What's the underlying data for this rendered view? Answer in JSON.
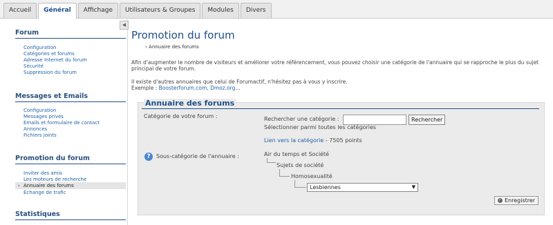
{
  "tabs": [
    "Accueil",
    "Général",
    "Affichage",
    "Utilisateurs & Groupes",
    "Modules",
    "Divers"
  ],
  "sidebar": {
    "collapse_glyph": "◀",
    "sections": [
      {
        "title": "Forum",
        "items": [
          "Configuration",
          "Catégories et forums",
          "Adresse Internet du forum",
          "Sécurité",
          "Suppression du forum"
        ]
      },
      {
        "title": "Messages et Emails",
        "items": [
          "Configuration",
          "Messages privés",
          "Emails et formulaire de contact",
          "Annonces",
          "Fichiers joints"
        ]
      },
      {
        "title": "Promotion du forum",
        "items": [
          "Inviter des amis",
          "Les moteurs de recherche",
          "Annuaire des forums",
          "Échange de trafic"
        ]
      },
      {
        "title": "Statistiques",
        "items": []
      }
    ]
  },
  "main": {
    "title": "Promotion du forum",
    "breadcrumb": "› Annuaire des forums",
    "intro": "Afin d'augmenter le nombre de visiteurs et améliorer votre référencement, vous pouvez choisir une catégorie de l'annuaire qui se rapproche le plus du sujet principal de votre forum.",
    "other_line": "Il existe d'autres annuaires que celui de Forumactif, n'hésitez pas à vous y inscrire.",
    "example_prefix": "Exemple : ",
    "example_link1": "Boosterforum.com",
    "example_sep": ", ",
    "example_link2": "Dmoz.org",
    "example_suffix": "..."
  },
  "panel": {
    "title": "Annuaire des forums",
    "category_label": "Catégorie de votre forum :",
    "search_label": "Rechercher une catégorie :",
    "search_value": "",
    "search_button": "Rechercher",
    "select_all_link": "Sélectionner parmi toutes les catégories",
    "category_link": "Lien vers la catégorie",
    "points": " - 7505 points",
    "subcat_label": "Sous-catégorie de l'annuaire :",
    "tree": [
      "Air du temps et Société",
      "Sujets de société",
      "Homosexualité"
    ],
    "select_value": "Lesbiennes",
    "save_button": "Enregistrer"
  }
}
